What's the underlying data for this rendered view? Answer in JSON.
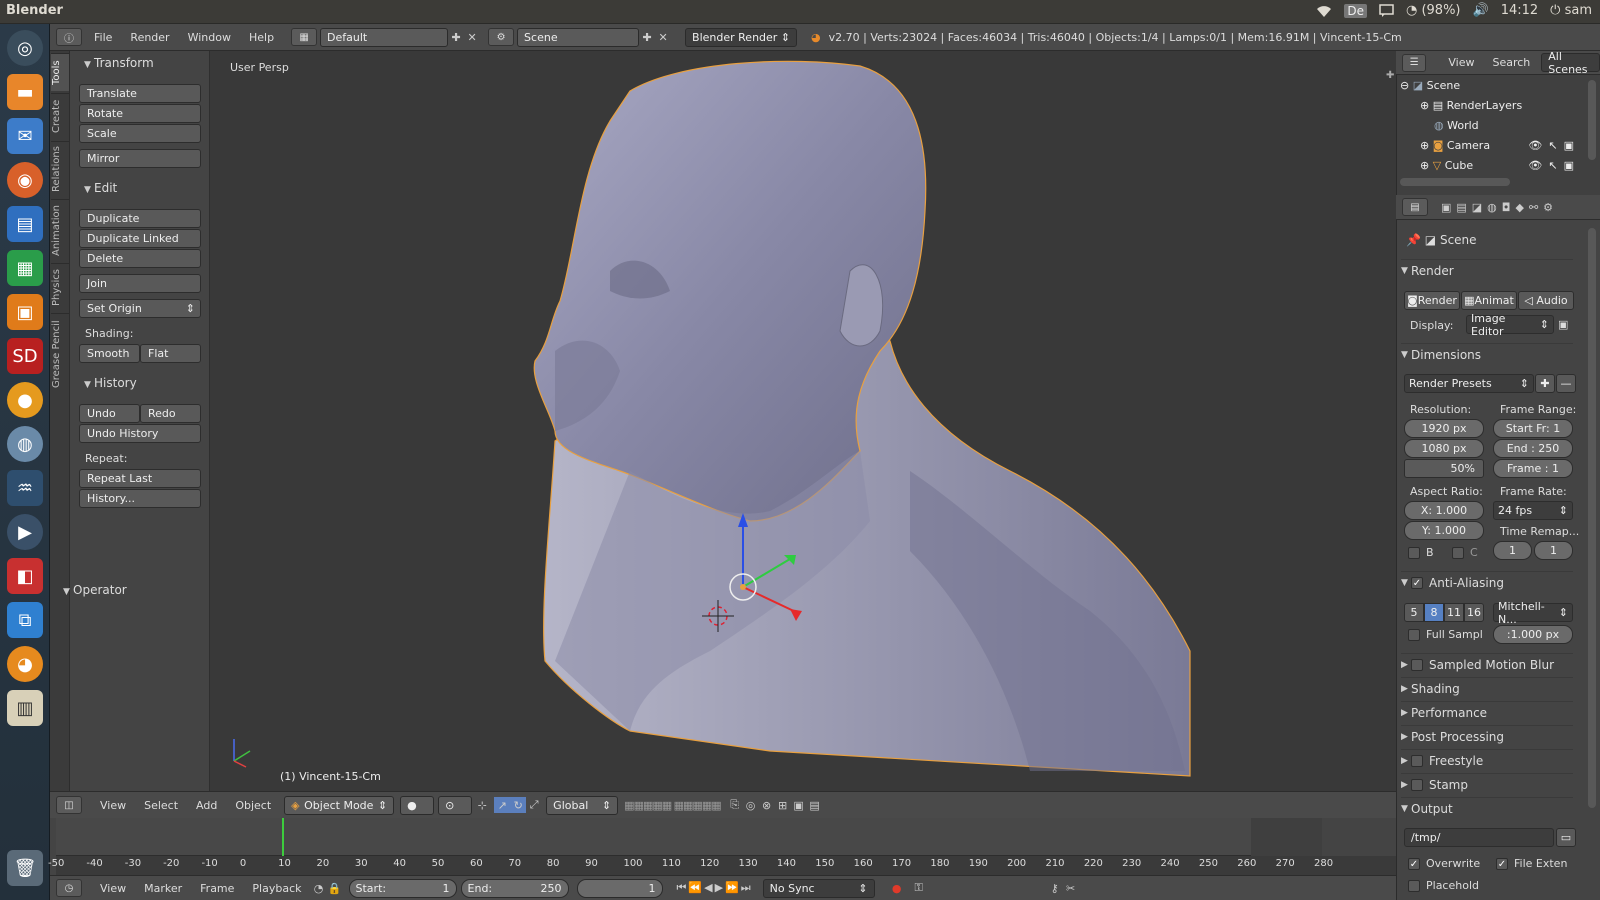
{
  "os": {
    "app_title": "Blender",
    "battery": "(98%)",
    "keyboard": "De",
    "time": "14:12",
    "user": "sam"
  },
  "info_bar": {
    "menus": [
      "File",
      "Render",
      "Window",
      "Help"
    ],
    "layout": "Default",
    "scene": "Scene",
    "engine": "Blender Render",
    "stats": "v2.70 | Verts:23024 | Faces:46034 | Tris:46040 | Objects:1/4 | Lamps:0/1 | Mem:16.91M | Vincent-15-Cm"
  },
  "tool_tabs": [
    "Tools",
    "Create",
    "Relations",
    "Animation",
    "Physics",
    "Grease Pencil"
  ],
  "tool_shelf": {
    "transform_title": "Transform",
    "translate": "Translate",
    "rotate": "Rotate",
    "scale": "Scale",
    "mirror": "Mirror",
    "edit_title": "Edit",
    "duplicate": "Duplicate",
    "duplicate_linked": "Duplicate Linked",
    "delete": "Delete",
    "join": "Join",
    "set_origin": "Set Origin",
    "shading_label": "Shading:",
    "smooth": "Smooth",
    "flat": "Flat",
    "history_title": "History",
    "undo": "Undo",
    "redo": "Redo",
    "undo_history": "Undo History",
    "repeat_label": "Repeat:",
    "repeat_last": "Repeat Last",
    "history_dots": "History...",
    "operator_title": "Operator"
  },
  "viewport": {
    "view_label": "User Persp",
    "object_label": "(1) Vincent-15-Cm"
  },
  "viewport_header": {
    "menus": [
      "View",
      "Select",
      "Add",
      "Object"
    ],
    "mode": "Object Mode",
    "orientation": "Global"
  },
  "timeline": {
    "ticks": [
      "-50",
      "-40",
      "-30",
      "-20",
      "-10",
      "0",
      "10",
      "20",
      "30",
      "40",
      "50",
      "60",
      "70",
      "80",
      "90",
      "100",
      "110",
      "120",
      "130",
      "140",
      "150",
      "160",
      "170",
      "180",
      "190",
      "200",
      "210",
      "220",
      "230",
      "240",
      "250",
      "260",
      "270",
      "280"
    ],
    "menus": [
      "View",
      "Marker",
      "Frame",
      "Playback"
    ],
    "start_label": "Start:",
    "start_value": "1",
    "end_label": "End:",
    "end_value": "250",
    "current_frame": "1",
    "sync": "No Sync"
  },
  "outliner": {
    "header": [
      "View",
      "Search",
      "All Scenes"
    ],
    "items": [
      "Scene",
      "RenderLayers",
      "World",
      "Camera",
      "Cube"
    ]
  },
  "properties": {
    "breadcrumb": "Scene",
    "render_title": "Render",
    "render_btn": "Render",
    "animation_btn": "Animat",
    "audio_btn": "Audio",
    "display_label": "Display:",
    "display_value": "Image Editor",
    "dimensions_title": "Dimensions",
    "render_presets": "Render Presets",
    "resolution_label": "Resolution:",
    "res_x": "1920 px",
    "res_y": "1080 px",
    "res_percent": "50%",
    "frame_range_label": "Frame Range:",
    "start_fr": "Start Fr: 1",
    "end_fr": "End : 250",
    "frame": "Frame : 1",
    "aspect_label": "Aspect Ratio:",
    "aspect_x": "X:  1.000",
    "aspect_y": "Y:  1.000",
    "frame_rate_label": "Frame Rate:",
    "fps": "24 fps",
    "time_remap_label": "Time Remap...",
    "border_b": "B",
    "border_c": "C",
    "remap_old": "1",
    "remap_new": "1",
    "aa_title": "Anti-Aliasing",
    "aa_samples": [
      "5",
      "8",
      "11",
      "16"
    ],
    "aa_filter": "Mitchell-N...",
    "full_sample": "Full Sampl",
    "filter_size": ":1.000 px",
    "collapsed_panels": [
      "Sampled Motion Blur",
      "Shading",
      "Performance",
      "Post Processing",
      "Freestyle",
      "Stamp"
    ],
    "output_title": "Output",
    "output_path": "/tmp/",
    "overwrite": "Overwrite",
    "file_extensions": "File Exten",
    "placeholders": "Placehold"
  }
}
